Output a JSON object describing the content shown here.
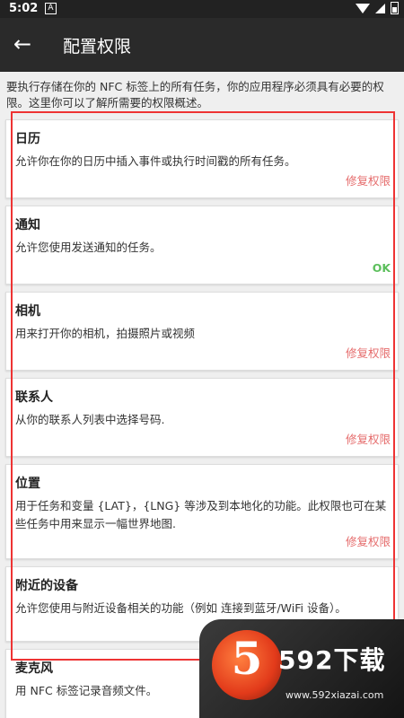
{
  "status_bar": {
    "time": "5:02",
    "notif_icon": "A"
  },
  "app_bar": {
    "title": "配置权限"
  },
  "intro": "要执行存储在你的 NFC 标签上的所有任务，你的应用程序必须具有必要的权限。这里你可以了解所需要的权限概述。",
  "permissions": [
    {
      "title": "日历",
      "desc": "允许你在你的日历中插入事件或执行时间戳的所有任务。",
      "action": "修复权限"
    },
    {
      "title": "通知",
      "desc": "允许您使用发送通知的任务。",
      "action": "OK"
    },
    {
      "title": "相机",
      "desc": "用来打开你的相机，拍摄照片或视频",
      "action": "修复权限"
    },
    {
      "title": "联系人",
      "desc": "从你的联系人列表中选择号码.",
      "action": "修复权限"
    },
    {
      "title": "位置",
      "desc": "用于任务和变量 {LAT}，{LNG} 等涉及到本地化的功能。此权限也可在某些任务中用来显示一幅世界地图.",
      "action": "修复权限"
    },
    {
      "title": "附近的设备",
      "desc": "允许您使用与附近设备相关的功能（例如 连接到蓝牙/WiFi 设备）。",
      "action": ""
    },
    {
      "title": "麦克风",
      "desc": "用 NFC 标签记录音频文件。",
      "action": ""
    }
  ],
  "watermark": {
    "badge": "5",
    "brand": "592下载",
    "url": "www.592xiazai.com"
  },
  "colors": {
    "action_fix": "#e56b6b",
    "action_ok": "#5cbf5c",
    "highlight": "#e33"
  }
}
